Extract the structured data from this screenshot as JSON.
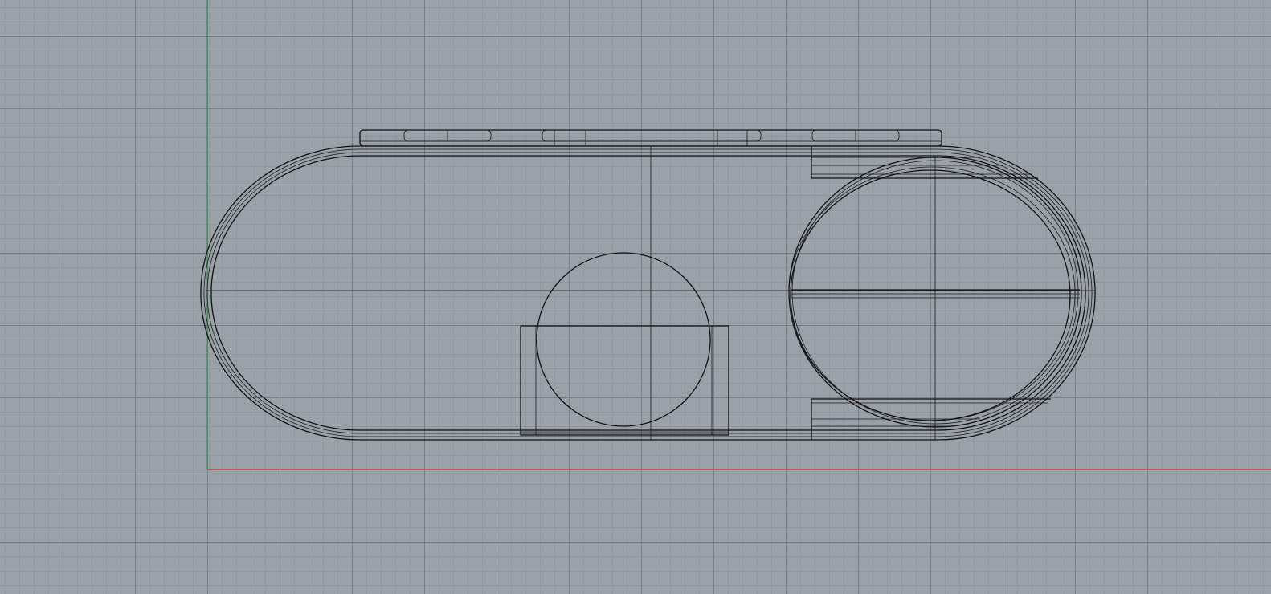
{
  "viewport": {
    "name": "Top",
    "view": "top",
    "display_mode": "wireframe",
    "colors": {
      "background": "#9aa1a9",
      "grid_major": "#787e86",
      "grid_minor": "#8a9098",
      "x_axis": "#c03030",
      "y_axis": "#2f9a3a",
      "wire": "#111111"
    }
  },
  "model": {
    "parts": [
      "capsule-outline",
      "top-clip-strip",
      "center-circle",
      "center-bracket",
      "right-ellipse",
      "right-upper-tab",
      "right-lower-tab"
    ]
  }
}
